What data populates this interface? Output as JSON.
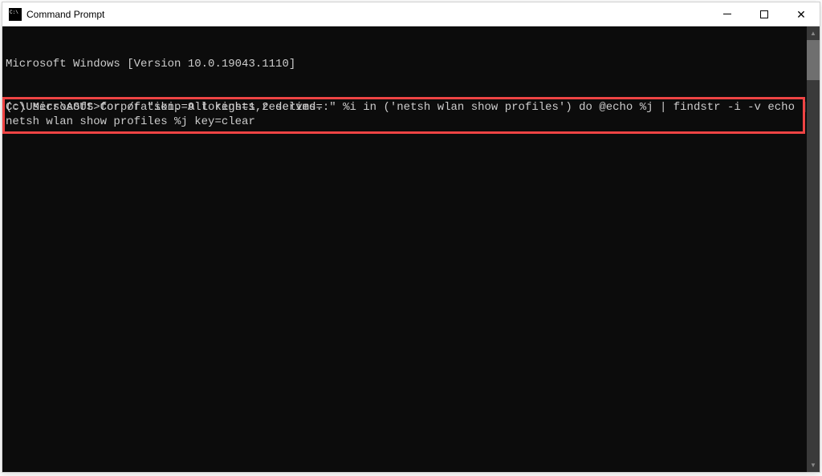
{
  "window": {
    "title": "Command Prompt"
  },
  "terminal": {
    "line1": "Microsoft Windows [Version 10.0.19043.1110]",
    "line2": "(c) Microsoft Corporation. All rights reserved.",
    "prompt": "C:\\Users\\ASUS>",
    "command_line1": "for /f \"skip=9 tokens=1,2 delims=:\" %i in ('netsh wlan show profiles') do @echo %j | findstr -i -v echo |",
    "command_line2": "netsh wlan show profiles %j key=clear"
  }
}
